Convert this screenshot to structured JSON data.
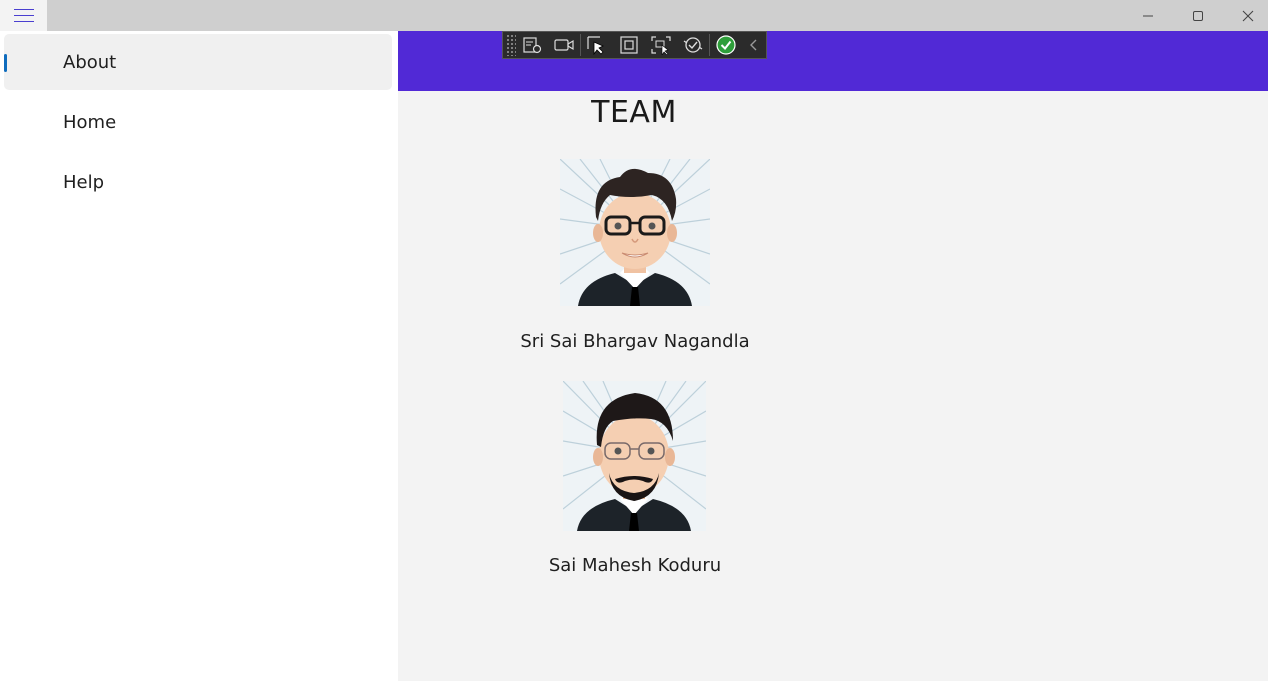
{
  "window": {
    "menu_icon": "hamburger-icon",
    "controls": [
      "minimize-icon",
      "maximize-icon",
      "close-icon"
    ]
  },
  "nav": {
    "items": [
      {
        "label": "About",
        "selected": true
      },
      {
        "label": "Home",
        "selected": false
      },
      {
        "label": "Help",
        "selected": false
      }
    ]
  },
  "debug_toolbar": {
    "icons": [
      "live-visual-tree-icon",
      "record-icon",
      "select-element-icon",
      "display-layout-adorners-icon",
      "track-focus-icon",
      "hot-reload-icon",
      "check-icon",
      "collapse-chevron-icon"
    ]
  },
  "page": {
    "header_color": "#5129d6",
    "title": "TEAM",
    "members": [
      {
        "name": "Sri Sai Bhargav Nagandla",
        "avatar": "avatar-bhargav-icon"
      },
      {
        "name": "Sai Mahesh Koduru",
        "avatar": "avatar-mahesh-icon"
      }
    ]
  }
}
